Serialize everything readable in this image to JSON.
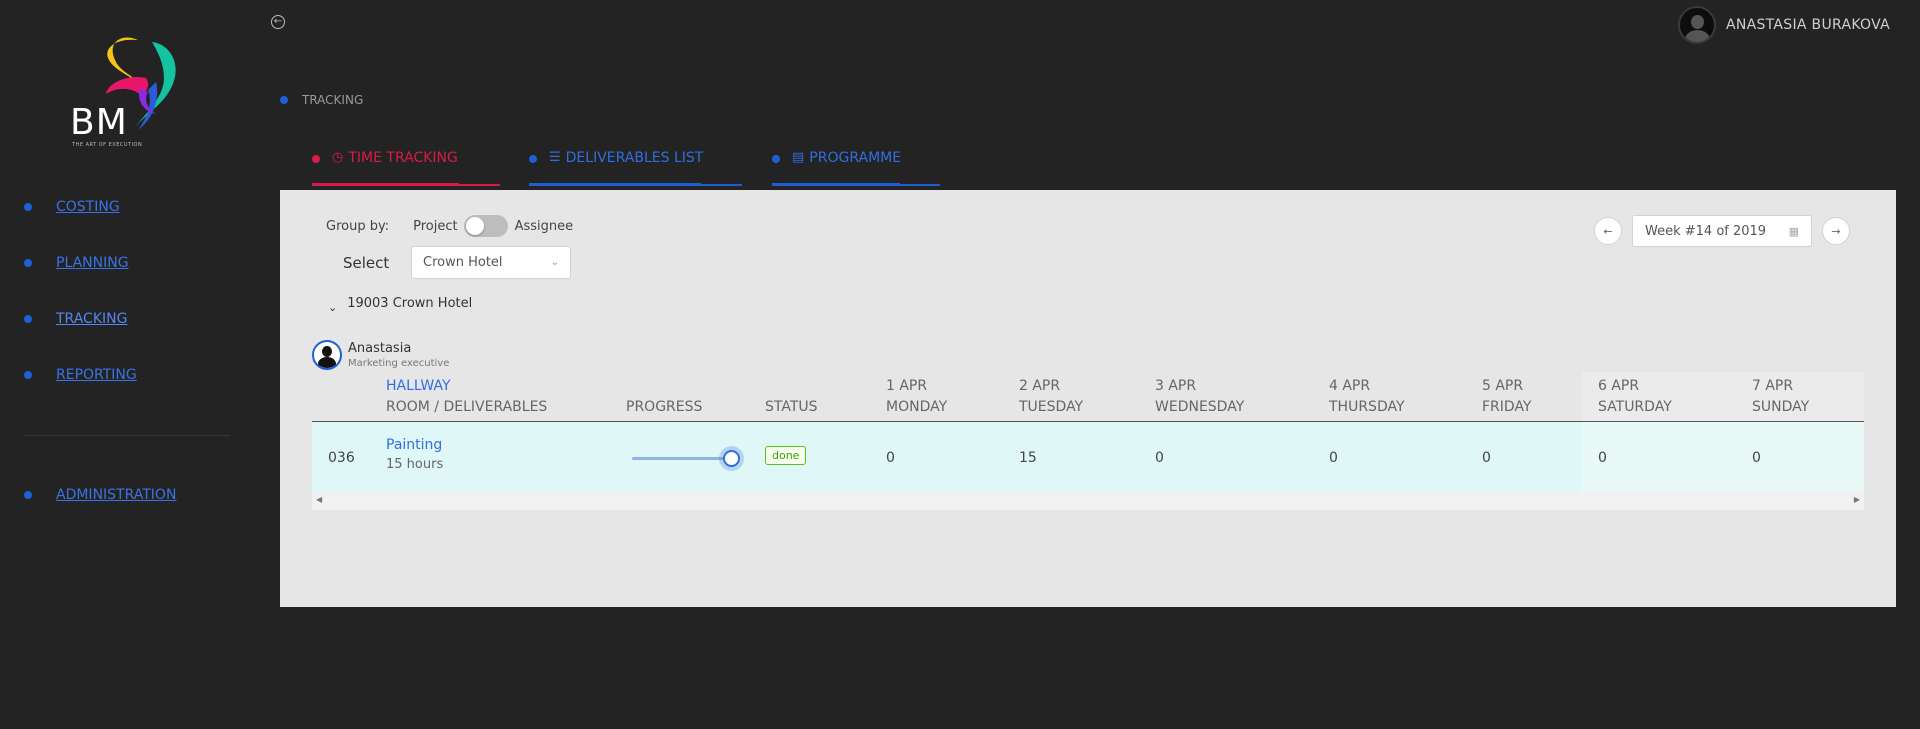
{
  "app": {
    "logo_text": "BM",
    "logo_tagline": "THE ART OF EXECUTION"
  },
  "sidebar": {
    "items": [
      {
        "label": "COSTING"
      },
      {
        "label": "PLANNING"
      },
      {
        "label": "TRACKING"
      },
      {
        "label": "REPORTING"
      },
      {
        "label": "ADMINISTRATION"
      }
    ]
  },
  "header": {
    "user_name": "ANASTASIA BURAKOVA",
    "breadcrumb": "TRACKING"
  },
  "tabs": [
    {
      "label": "TIME TRACKING",
      "icon": "clock-icon"
    },
    {
      "label": "DELIVERABLES LIST",
      "icon": "list-icon"
    },
    {
      "label": "PROGRAMME",
      "icon": "clipboard-icon"
    }
  ],
  "filters": {
    "group_by_label": "Group by:",
    "toggle_left": "Project",
    "toggle_right": "Assignee",
    "select_label": "Select",
    "select_value": "Crown Hotel",
    "week_value": "Week #14 of 2019"
  },
  "group": {
    "title": "19003 Crown Hotel"
  },
  "person": {
    "name": "Anastasia",
    "role": "Marketing executive"
  },
  "table": {
    "room": "HALLWAY",
    "col_room": "ROOM / DELIVERABLES",
    "col_progress": "PROGRESS",
    "col_status": "STATUS",
    "days": [
      {
        "date": "1 APR",
        "day": "MONDAY"
      },
      {
        "date": "2 APR",
        "day": "TUESDAY"
      },
      {
        "date": "3 APR",
        "day": "WEDNESDAY"
      },
      {
        "date": "4 APR",
        "day": "THURSDAY"
      },
      {
        "date": "5 APR",
        "day": "FRIDAY"
      },
      {
        "date": "6 APR",
        "day": "SATURDAY"
      },
      {
        "date": "7 APR",
        "day": "SUNDAY"
      }
    ],
    "rows": [
      {
        "code": "036",
        "task": "Painting",
        "hours": "15 hours",
        "progress": 1.0,
        "status": "done",
        "values": [
          "0",
          "15",
          "0",
          "0",
          "0",
          "0",
          "0"
        ]
      }
    ]
  },
  "colors": {
    "accent_red": "#d81b48",
    "accent_blue": "#1e5fd6",
    "done_green": "#52c41a"
  }
}
